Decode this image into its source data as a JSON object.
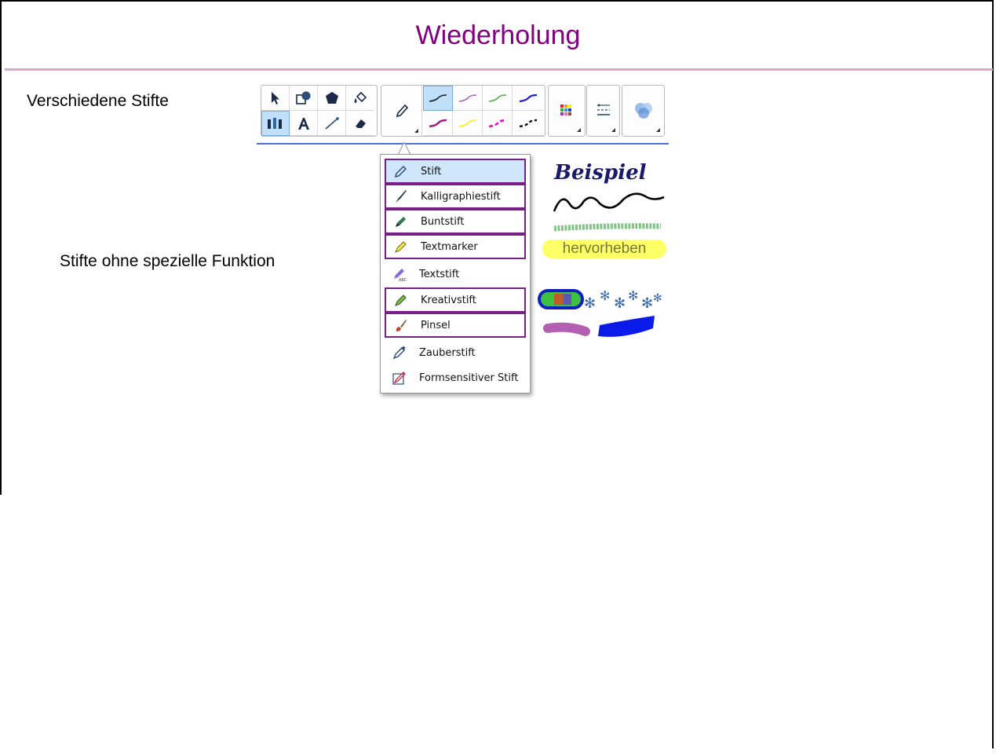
{
  "slide": {
    "title": "Wiederholung",
    "label_pens": "Verschiedene Stifte",
    "label_plain": "Stifte ohne spezielle Funktion"
  },
  "toolbar": {
    "tools": [
      {
        "name": "select",
        "icon": "arrow-icon"
      },
      {
        "name": "shapes",
        "icon": "shapes-icon"
      },
      {
        "name": "regular-polygon",
        "icon": "polygon-icon"
      },
      {
        "name": "fill",
        "icon": "paint-bucket-icon"
      },
      {
        "name": "pens",
        "icon": "pens-icon",
        "selected": true
      },
      {
        "name": "text",
        "icon": "text-icon"
      },
      {
        "name": "line",
        "icon": "line-icon"
      },
      {
        "name": "eraser",
        "icon": "eraser-icon"
      }
    ],
    "pen_colors": [
      "#1a1a1a",
      "#b060c0",
      "#50b040",
      "#2020d0",
      "#a02080",
      "#ffee00",
      "#ff00cc",
      "#111111"
    ]
  },
  "pen_menu": {
    "items": [
      {
        "label": "Stift",
        "icon": "pen-icon",
        "active": true,
        "boxed": true
      },
      {
        "label": "Kalligraphiestift",
        "icon": "calligraphy-pen-icon",
        "boxed": true
      },
      {
        "label": "Buntstift",
        "icon": "crayon-icon",
        "boxed": true
      },
      {
        "label": "Textmarker",
        "icon": "highlighter-icon",
        "boxed": true
      },
      {
        "label": "Textstift",
        "icon": "text-pen-icon",
        "boxed": false
      },
      {
        "label": "Kreativstift",
        "icon": "creative-pen-icon",
        "boxed": true
      },
      {
        "label": "Pinsel",
        "icon": "brush-icon",
        "boxed": true
      },
      {
        "label": "Zauberstift",
        "icon": "magic-pen-icon",
        "boxed": false
      },
      {
        "label": "Formsensitiver Stift",
        "icon": "shape-pen-icon",
        "boxed": false
      }
    ]
  },
  "samples": {
    "handwriting": "Beispiel",
    "highlight_text": "hervorheben"
  }
}
